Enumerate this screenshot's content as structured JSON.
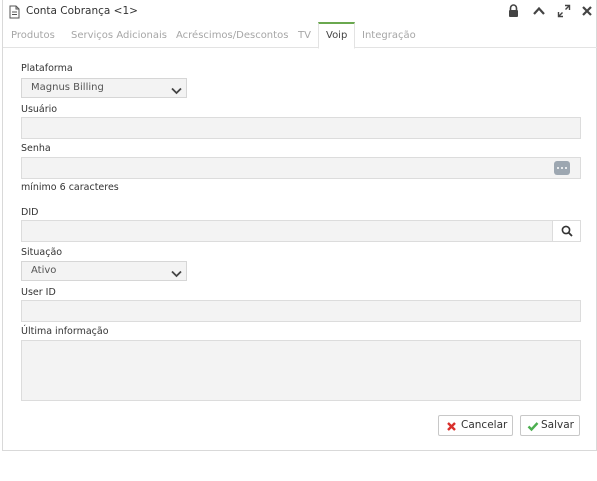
{
  "window": {
    "title": "Conta Cobrança <1>"
  },
  "tabs": [
    {
      "label": "Produtos",
      "active": false
    },
    {
      "label": "Serviços Adicionais",
      "active": false
    },
    {
      "label": "Acréscimos/Descontos",
      "active": false
    },
    {
      "label": "TV",
      "active": false
    },
    {
      "label": "Voip",
      "active": true
    },
    {
      "label": "Integração",
      "active": false
    }
  ],
  "form": {
    "plataforma": {
      "label": "Plataforma",
      "value": "Magnus Billing"
    },
    "usuario": {
      "label": "Usuário",
      "value": ""
    },
    "senha": {
      "label": "Senha",
      "value": "",
      "hint": "mínimo 6 caracteres"
    },
    "did": {
      "label": "DID",
      "value": ""
    },
    "situacao": {
      "label": "Situação",
      "value": "Ativo"
    },
    "user_id": {
      "label": "User ID",
      "value": ""
    },
    "ultima_informacao": {
      "label": "Última informação",
      "value": ""
    }
  },
  "buttons": {
    "cancel": "Cancelar",
    "save": "Salvar"
  },
  "colors": {
    "active_tab_accent": "#6aa84f",
    "cancel_icon": "#d9302c",
    "save_icon": "#4caf50"
  }
}
